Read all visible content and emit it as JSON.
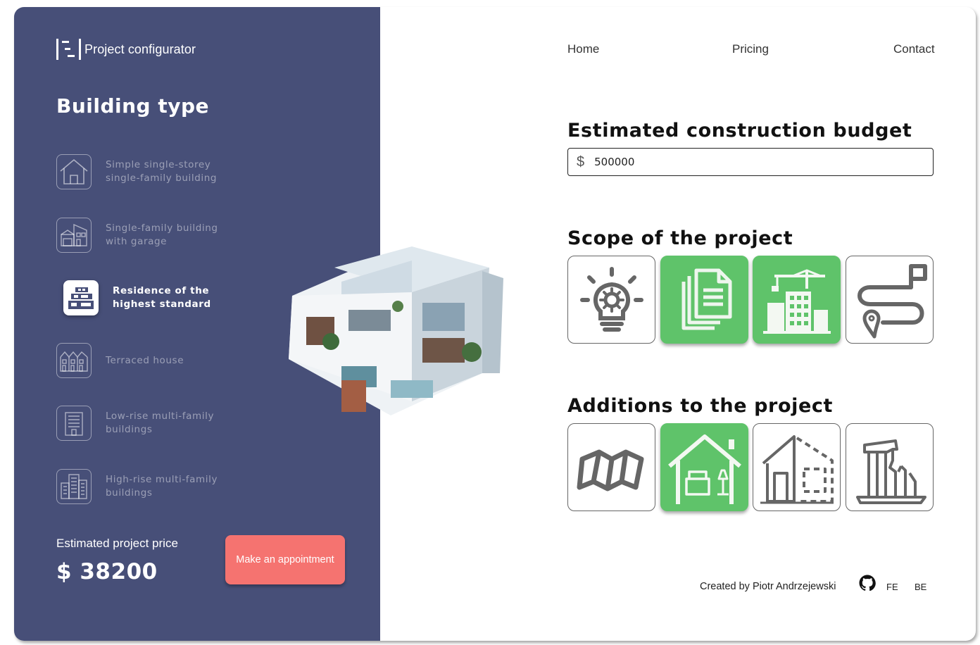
{
  "app": {
    "title": "Project configurator",
    "logo_icon": "logo-icon"
  },
  "nav": {
    "home": "Home",
    "pricing": "Pricing",
    "contact": "Contact"
  },
  "sidebar": {
    "title": "Building type",
    "items": [
      {
        "label": "Simple single-storey single-family building",
        "icon": "house-icon",
        "active": false
      },
      {
        "label": "Single-family building with garage",
        "icon": "house-garage-icon",
        "active": false
      },
      {
        "label": "Residence of the highest standard",
        "icon": "residence-icon",
        "active": true
      },
      {
        "label": "Terraced house",
        "icon": "terraced-house-icon",
        "active": false
      },
      {
        "label": "Low-rise multi-family buildings",
        "icon": "low-rise-building-icon",
        "active": false
      },
      {
        "label": "High-rise multi-family buildings",
        "icon": "high-rise-building-icon",
        "active": false
      }
    ],
    "price_label": "Estimated project price",
    "price_value": "$ 38200",
    "appointment_label": "Make an appointment"
  },
  "budget": {
    "title": "Estimated construction budget",
    "currency": "$",
    "value": "500000"
  },
  "scope": {
    "title": "Scope of the project",
    "tiles": [
      {
        "icon": "idea-bulb-icon",
        "selected": false
      },
      {
        "icon": "documents-icon",
        "selected": true
      },
      {
        "icon": "construction-crane-icon",
        "selected": true
      },
      {
        "icon": "route-plan-icon",
        "selected": false
      }
    ]
  },
  "additions": {
    "title": "Additions to the project",
    "tiles": [
      {
        "icon": "map-icon",
        "selected": false
      },
      {
        "icon": "interior-house-icon",
        "selected": true
      },
      {
        "icon": "house-extension-icon",
        "selected": false
      },
      {
        "icon": "ruined-building-icon",
        "selected": false
      }
    ]
  },
  "footer": {
    "credit": "Created by Piotr Andrzejewski",
    "github_icon": "github-icon",
    "fe": "FE",
    "be": "BE"
  },
  "colors": {
    "sidebar": "#474f78",
    "accent_green": "#5fc36a",
    "appointment": "#f57370"
  }
}
